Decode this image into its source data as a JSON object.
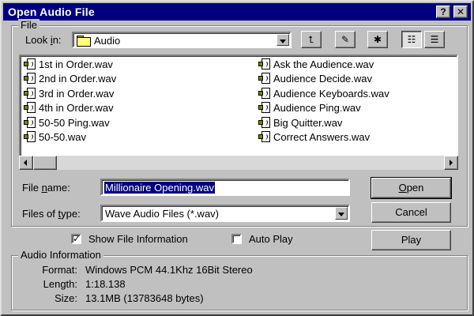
{
  "window": {
    "title": "Open Audio File",
    "help_glyph": "?",
    "close_glyph": "✕"
  },
  "file_group": {
    "title": "File",
    "look_in_label_pre": "Look ",
    "look_in_label_key": "i",
    "look_in_label_post": "n:",
    "look_in_value": "Audio"
  },
  "toolbar": {
    "up_glyph": "⮤",
    "desktop_glyph": "✎",
    "newfolder_glyph": "✱",
    "list_glyph": "☷",
    "details_glyph": "☰"
  },
  "files": {
    "column1": [
      "1st in Order.wav",
      "2nd in Order.wav",
      "3rd in Order.wav",
      "4th in Order.wav",
      "50-50 Ping.wav",
      "50-50.wav"
    ],
    "column2": [
      "Ask the Audience.wav",
      "Audience Decide.wav",
      "Audience Keyboards.wav",
      "Audience Ping.wav",
      "Big Quitter.wav",
      "Correct Answers.wav"
    ]
  },
  "filename": {
    "label_pre": "File ",
    "label_key": "n",
    "label_post": "ame:",
    "value": "Millionaire Opening.wav"
  },
  "filetype": {
    "label_pre": "Files of ",
    "label_key": "t",
    "label_post": "ype:",
    "value": "Wave Audio Files (*.wav)"
  },
  "buttons": {
    "open_key": "O",
    "open_rest": "pen",
    "cancel": "Cancel",
    "play": "Play"
  },
  "options": {
    "show_info_label": "Show File Information",
    "show_info_checked": true,
    "auto_play_label": "Auto Play",
    "auto_play_checked": false,
    "check_glyph": "✓"
  },
  "audio_info": {
    "title": "Audio Information",
    "format_label": "Format:",
    "format_value": "Windows PCM 44.1Khz 16Bit Stereo",
    "length_label": "Length:",
    "length_value": "1:18.138",
    "size_label": "Size:",
    "size_value": "13.1MB (13783648 bytes)"
  }
}
